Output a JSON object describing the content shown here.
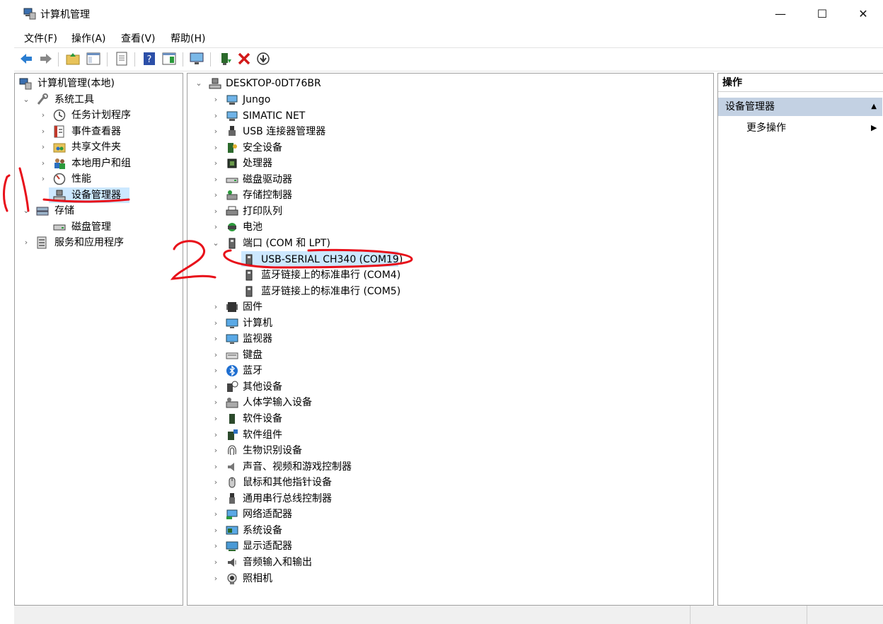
{
  "window": {
    "title": "计算机管理"
  },
  "menu": {
    "file": "文件(F)",
    "action": "操作(A)",
    "view": "查看(V)",
    "help": "帮助(H)"
  },
  "left_tree": {
    "root": "计算机管理(本地)",
    "system_tools": "系统工具",
    "task_scheduler": "任务计划程序",
    "event_viewer": "事件查看器",
    "shared_folders": "共享文件夹",
    "local_users": "本地用户和组",
    "performance": "性能",
    "device_manager": "设备管理器",
    "storage": "存储",
    "disk_management": "磁盘管理",
    "services_apps": "服务和应用程序"
  },
  "device_tree": {
    "computer_name": "DESKTOP-0DT76BR",
    "categories": [
      "Jungo",
      "SIMATIC NET",
      "USB 连接器管理器",
      "安全设备",
      "处理器",
      "磁盘驱动器",
      "存储控制器",
      "打印队列",
      "电池",
      "端口 (COM 和 LPT)"
    ],
    "ports": [
      "USB-SERIAL CH340 (COM19)",
      "蓝牙链接上的标准串行 (COM4)",
      "蓝牙链接上的标准串行 (COM5)"
    ],
    "categories_after": [
      "固件",
      "计算机",
      "监视器",
      "键盘",
      "蓝牙",
      "其他设备",
      "人体学输入设备",
      "软件设备",
      "软件组件",
      "生物识别设备",
      "声音、视频和游戏控制器",
      "鼠标和其他指针设备",
      "通用串行总线控制器",
      "网络适配器",
      "系统设备",
      "显示适配器",
      "音频输入和输出",
      "照相机"
    ]
  },
  "actions": {
    "header": "操作",
    "section": "设备管理器",
    "more": "更多操作"
  },
  "colors": {
    "selection": "#cce8ff",
    "action_section": "#c3d1e3",
    "annotation": "#e8101a"
  },
  "annotations": {
    "one": "1",
    "two": "2"
  }
}
